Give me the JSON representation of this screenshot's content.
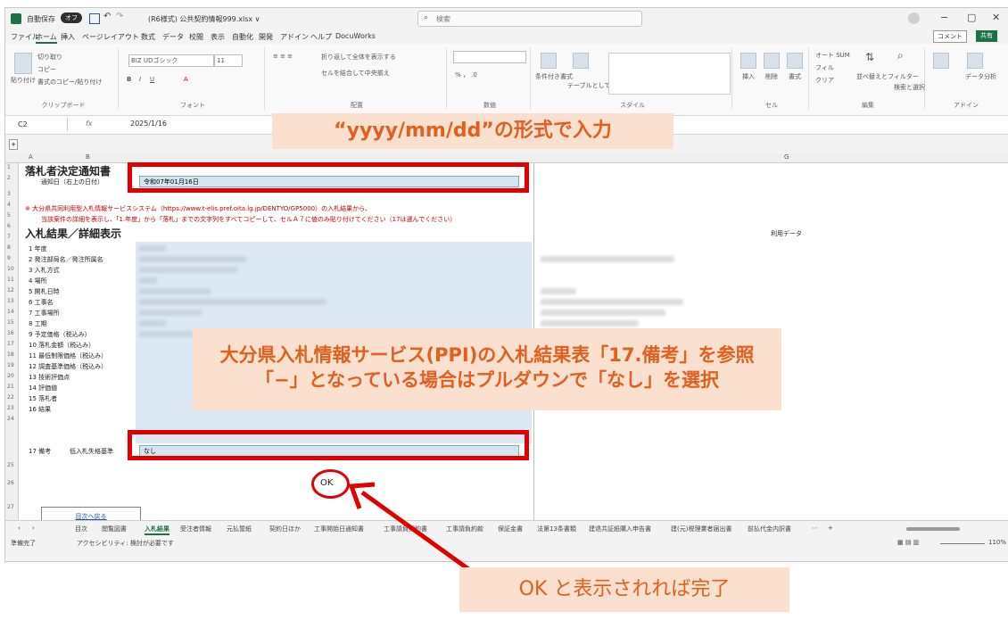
{
  "titlebar": {
    "autosave": "自動保存",
    "toggle": "オフ",
    "filename": "(R6様式) 公共契約情報999.xlsx ∨",
    "search_placeholder": "検索",
    "minimize": "−",
    "restore": "▢",
    "close": "✕"
  },
  "menu": {
    "items": [
      "ファイル",
      "ホーム",
      "挿入",
      "ページレイアウト",
      "数式",
      "データ",
      "校閲",
      "表示",
      "自動化",
      "開発",
      "アドイン",
      "ヘルプ",
      "DocuWorks"
    ],
    "comment": "コメント",
    "share": "共有"
  },
  "ribbon": {
    "cut": "切り取り",
    "paste": "貼り付け",
    "copy": "コピー",
    "format_painter": "書式のコピー/貼り付け",
    "clipboard": "クリップボード",
    "font_name": "BIZ UDゴシック",
    "font_size": "11",
    "font_group": "フォント",
    "wrap": "折り返して全体を表示する",
    "merge": "セルを結合して中央揃え",
    "align_group": "配置",
    "number_group": "数値",
    "cond_format": "条件付き書式",
    "table_format": "テーブルとして書式設定",
    "style_group": "スタイル",
    "insert": "挿入",
    "delete": "削除",
    "format": "書式",
    "cells_group": "セル",
    "autosum": "オート SUM",
    "fill": "フィル",
    "clear": "クリア",
    "sort": "並べ替えとフィルター",
    "find": "検索と選択",
    "edit_group": "編集",
    "addin_group": "アドイン",
    "analyze": "データ分析"
  },
  "formula_bar": {
    "cell": "C2",
    "fx": "fx",
    "value": "2025/1/16"
  },
  "columns": [
    "A",
    "B",
    "G"
  ],
  "rows": [
    "1",
    "2",
    "3",
    "4",
    "5",
    "6",
    "7",
    "8",
    "9",
    "10",
    "11",
    "12",
    "13",
    "14",
    "15",
    "16",
    "17",
    "18",
    "19",
    "20",
    "21",
    "22",
    "23",
    "24",
    "25",
    "26",
    "27"
  ],
  "sheet": {
    "title": "落札者決定通知書",
    "notice_date_label": "通知日（右上の日付）",
    "notice_date_value": "令和07年01月16日",
    "red_line1": "※ 大分県共同利用型入札情報サービスシステム（https://www.t-elis.pref.oita.lg.jp/DENTYO/GP5000）の入札結果から、",
    "red_line2": "当該案件の詳細を表示し、「1.年度」から「落札」までの文字列をすべてコピーして、セルＡ７に値のみ貼り付けてください（17は選んでください）",
    "section_title": "入札結果／詳細表示",
    "usage_data": "利用データ",
    "items": [
      "1 年度",
      "2 発注部局名／発注所属名",
      "3 入札方式",
      "4 場所",
      "5 開札日時",
      "6 工事名",
      "7 工事場所",
      "8 工期",
      "9 予定価格（税込み）",
      "10 落札金額（税込み）",
      "11 最低制限価格（税込み）",
      "12 調査基準価格（税込み）",
      "13 技術評価点",
      "14 評価値",
      "15 落札者",
      "16 結果"
    ],
    "remarks_label": "17 備考",
    "remarks_sub": "低入札失格基準",
    "remarks_value": "なし",
    "ok": "OK",
    "back_button": "目次へ戻る"
  },
  "tabs": [
    "目次",
    "閲覧図書",
    "入札結果",
    "受注者情報",
    "元払誓紙",
    "契約日ほか",
    "工事開始日通知書",
    "工事請負契約書",
    "工事請負約款",
    "保証金書",
    "法第13条書類",
    "建退共証紙購入申告書",
    "建(元)税理業者届出書",
    "前払代金内訳書"
  ],
  "status": {
    "ready": "準備完了",
    "accessibility": "アクセシビリティ: 検討が必要です",
    "zoom": "110%"
  },
  "annotations": {
    "top": "“yyyy/mm/dd”の形式で入力",
    "middle_line1": "大分県入札情報サービス(PPI)の入札結果表「17.備考」を参照",
    "middle_line2": "「−」となっている場合はプルダウンで「なし」を選択",
    "bottom": "OK と表示されれば完了"
  },
  "colors": {
    "accent": "#1e7145",
    "highlight_red": "#e00000",
    "callout_bg": "#fbe0cf",
    "callout_text": "#e06020"
  }
}
